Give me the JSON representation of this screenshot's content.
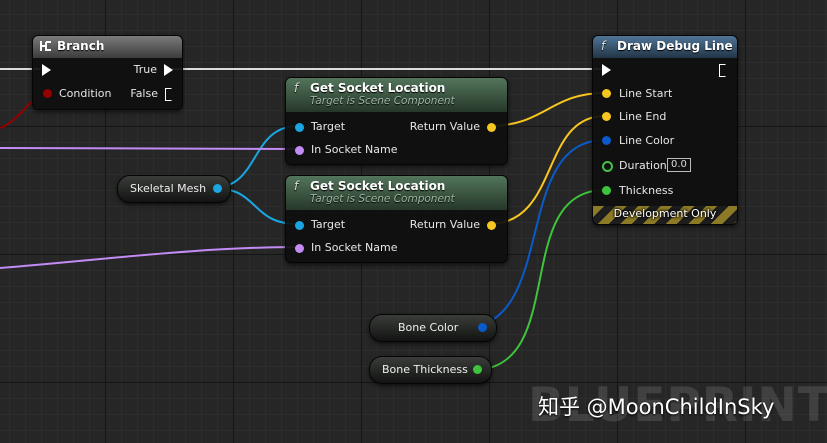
{
  "branch": {
    "title": "Branch",
    "true_label": "True",
    "condition_label": "Condition",
    "false_label": "False"
  },
  "get_socket_1": {
    "title": "Get Socket Location",
    "subtitle": "Target is Scene Component",
    "target_label": "Target",
    "return_label": "Return Value",
    "socket_label": "In Socket Name"
  },
  "get_socket_2": {
    "title": "Get Socket Location",
    "subtitle": "Target is Scene Component",
    "target_label": "Target",
    "return_label": "Return Value",
    "socket_label": "In Socket Name"
  },
  "skeletal_mesh": {
    "label": "Skeletal Mesh"
  },
  "draw_debug": {
    "title": "Draw Debug Line",
    "line_start": "Line Start",
    "line_end": "Line End",
    "line_color": "Line Color",
    "duration": "Duration",
    "duration_value": "0.0",
    "thickness": "Thickness",
    "dev_only": "Development Only"
  },
  "bone_color": {
    "label": "Bone Color"
  },
  "bone_thickness": {
    "label": "Bone Thickness"
  },
  "function_glyph": "f",
  "watermark": "BLUEPRINT",
  "credit": "知乎 @MoonChildInSky",
  "colors": {
    "exec": "#ffffff",
    "bool": "#950000",
    "object": "#1aa6e3",
    "name": "#c38bf4",
    "vector": "#f8c621",
    "color": "#0a5ac9",
    "float": "#3ec43c"
  }
}
